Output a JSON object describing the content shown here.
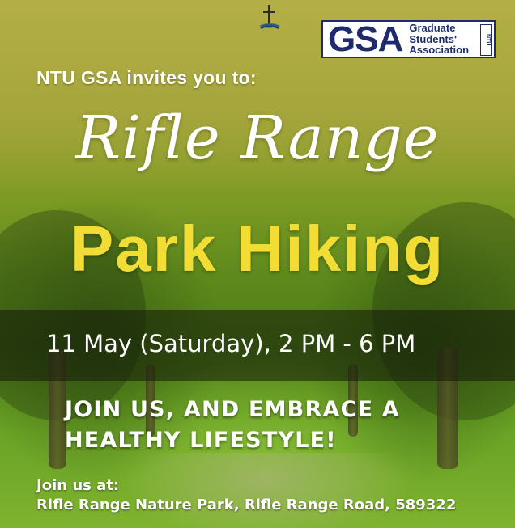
{
  "header": {
    "org_logo": {
      "mark": "GSA",
      "line1": "Graduate",
      "line2": "Students'",
      "line3": "Association",
      "side_tag": "NTU",
      "brand_color": "#1f2b6b"
    },
    "top_icon": "cross-icon"
  },
  "invite_line": "NTU GSA invites you to:",
  "title": {
    "script": "Rifle Range",
    "bold": "Park Hiking",
    "bold_color": "#f2dd35"
  },
  "event": {
    "datetime": "11 May (Saturday), 2 PM - 6 PM"
  },
  "slogan": {
    "line1": "JOIN US, AND EMBRACE A",
    "line2": "HEALTHY LIFESTYLE!"
  },
  "location": {
    "label": "Join us at:",
    "address": "Rifle Range Nature Park, Rifle Range Road, 589322"
  }
}
